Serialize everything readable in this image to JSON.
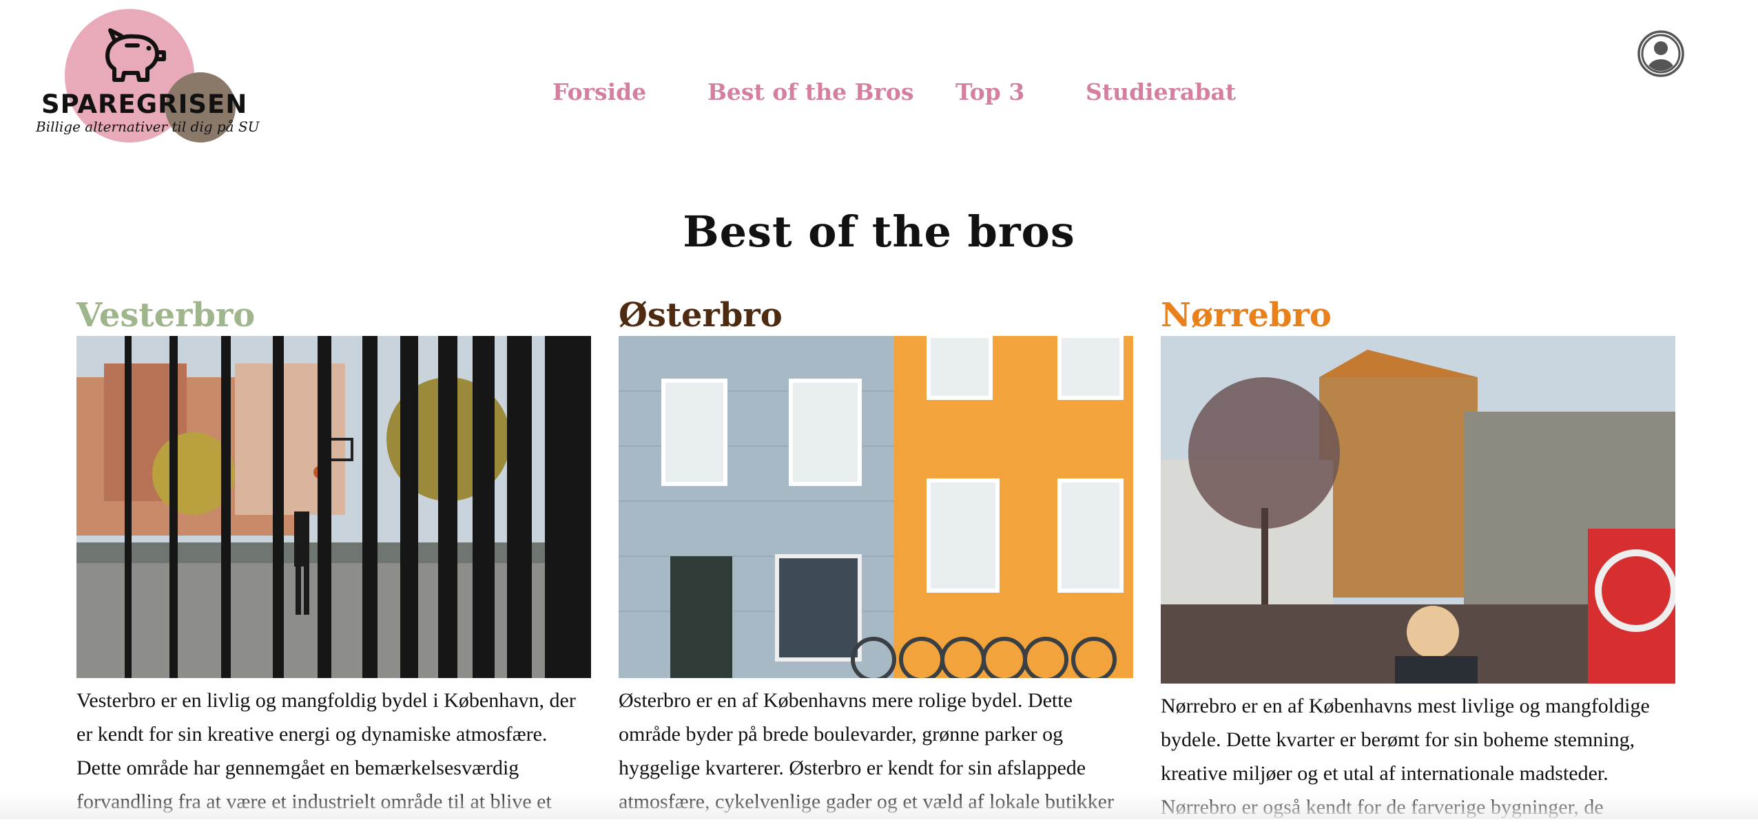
{
  "header": {
    "logo": {
      "brand": "SPAREGRISEN",
      "tagline": "Billige alternativer til dig på SU",
      "icon": "piggy-bank-icon"
    },
    "nav": [
      {
        "label": "Forside"
      },
      {
        "label": "Best of the Bros"
      },
      {
        "label": "Top 3"
      },
      {
        "label": "Studierabat"
      }
    ],
    "user_icon": "user-account-icon"
  },
  "main": {
    "title": "Best of the bros",
    "districts": [
      {
        "name": "Vesterbro",
        "color": "#9fb58c",
        "text": "Vesterbro er en livlig og mangfoldig bydel i København, der er kendt for sin kreative energi og dynamiske atmosfære. Dette område har gennemgået en bemærkelsesværdig forvandling fra at være et industrielt område til at blive et"
      },
      {
        "name": "Østerbro",
        "color": "#4e2a10",
        "text": "Østerbro er en af Københavns mere rolige bydel. Dette område byder på brede boulevarder, grønne parker og hyggelige kvarterer. Østerbro er kendt for sin afslappede atmosfære, cykelvenlige gader og et væld af lokale butikker"
      },
      {
        "name": "Nørrebro",
        "color": "#e8801c",
        "text": "Nørrebro er en af Københavns mest livlige og mangfoldige bydele. Dette kvarter er berømt for sin boheme stemning, kreative miljøer og et utal af internationale madsteder. Nørrebro er også kendt for de farverige bygninger, de"
      }
    ]
  },
  "colors": {
    "nav": "#d47fa0",
    "logo_pink": "#e8aab8",
    "logo_brown": "#8a7868"
  }
}
